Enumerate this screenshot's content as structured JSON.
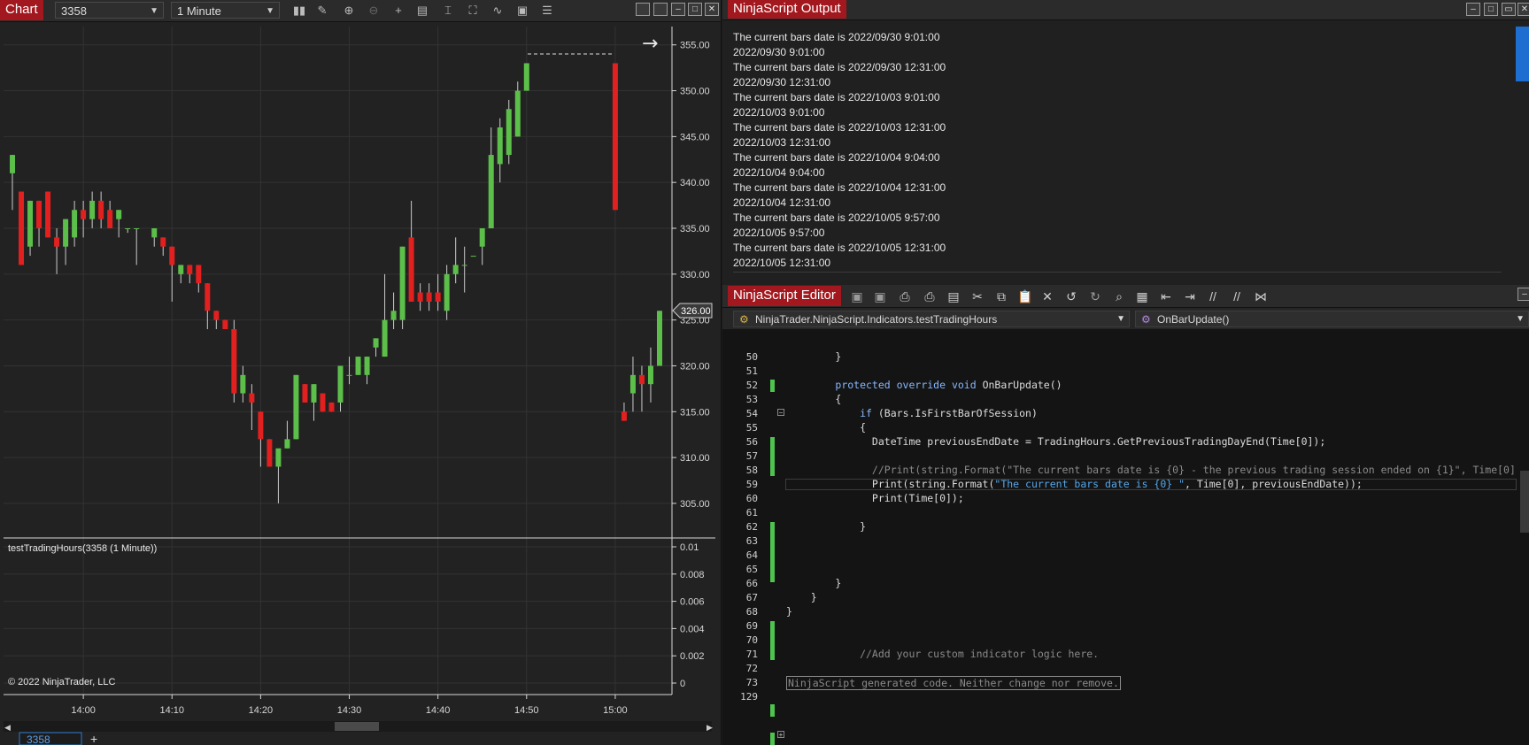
{
  "chart": {
    "tag": "Chart",
    "instrument": "3358",
    "interval": "1 Minute",
    "indicator_label": "testTradingHours(3358 (1 Minute))",
    "copyright": "© 2022 NinjaTrader, LLC",
    "current_price_label": "326.00",
    "tab_label": "3358",
    "add_tab": "+",
    "price_ticks": [
      "355.00",
      "350.00",
      "345.00",
      "340.00",
      "335.00",
      "330.00",
      "325.00",
      "320.00",
      "315.00",
      "310.00",
      "305.00"
    ],
    "indicator_ticks": [
      "0.01",
      "0.008",
      "0.006",
      "0.004",
      "0.002",
      "0"
    ],
    "time_ticks": [
      "14:00",
      "14:10",
      "14:20",
      "14:30",
      "14:40",
      "14:50",
      "15:00"
    ]
  },
  "chart_data": {
    "type": "candlestick",
    "price_range": [
      302,
      357
    ],
    "time_range_minutes": [
      "13:51",
      "15:06"
    ],
    "candles": [
      {
        "t": "13:52",
        "o": 341,
        "h": 343,
        "l": 337,
        "c": 343
      },
      {
        "t": "13:53",
        "o": 339,
        "h": 339,
        "l": 331,
        "c": 331
      },
      {
        "t": "13:54",
        "o": 333,
        "h": 338,
        "l": 332,
        "c": 338
      },
      {
        "t": "13:55",
        "o": 338,
        "h": 338,
        "l": 333,
        "c": 335
      },
      {
        "t": "13:56",
        "o": 339,
        "h": 339,
        "l": 334,
        "c": 334
      },
      {
        "t": "13:57",
        "o": 334,
        "h": 335,
        "l": 330,
        "c": 333
      },
      {
        "t": "13:58",
        "o": 333,
        "h": 336,
        "l": 331,
        "c": 336
      },
      {
        "t": "13:59",
        "o": 334,
        "h": 338,
        "l": 333,
        "c": 337
      },
      {
        "t": "14:00",
        "o": 337,
        "h": 338,
        "l": 334,
        "c": 336
      },
      {
        "t": "14:01",
        "o": 336,
        "h": 339,
        "l": 335,
        "c": 338
      },
      {
        "t": "14:02",
        "o": 338,
        "h": 339,
        "l": 335,
        "c": 336
      },
      {
        "t": "14:03",
        "o": 337,
        "h": 338,
        "l": 335,
        "c": 335
      },
      {
        "t": "14:04",
        "o": 336,
        "h": 337,
        "l": 334,
        "c": 337
      },
      {
        "t": "14:05",
        "o": 335,
        "h": 335,
        "l": 334.5,
        "c": 335
      },
      {
        "t": "14:06",
        "o": 335,
        "h": 335,
        "l": 331,
        "c": 335
      },
      {
        "t": "14:08",
        "o": 334,
        "h": 335,
        "l": 333,
        "c": 335
      },
      {
        "t": "14:09",
        "o": 334,
        "h": 334,
        "l": 332,
        "c": 333
      },
      {
        "t": "14:10",
        "o": 333,
        "h": 333,
        "l": 327,
        "c": 331
      },
      {
        "t": "14:11",
        "o": 330,
        "h": 331,
        "l": 329,
        "c": 331
      },
      {
        "t": "14:12",
        "o": 331,
        "h": 331,
        "l": 329,
        "c": 330
      },
      {
        "t": "14:13",
        "o": 331,
        "h": 331,
        "l": 328,
        "c": 329
      },
      {
        "t": "14:14",
        "o": 329,
        "h": 329,
        "l": 324,
        "c": 326
      },
      {
        "t": "14:15",
        "o": 326,
        "h": 326,
        "l": 324,
        "c": 325
      },
      {
        "t": "14:16",
        "o": 325,
        "h": 325,
        "l": 324,
        "c": 324
      },
      {
        "t": "14:17",
        "o": 324,
        "h": 325,
        "l": 316,
        "c": 317
      },
      {
        "t": "14:18",
        "o": 317,
        "h": 320,
        "l": 316,
        "c": 319
      },
      {
        "t": "14:19",
        "o": 317,
        "h": 318,
        "l": 313,
        "c": 316
      },
      {
        "t": "14:20",
        "o": 315,
        "h": 315,
        "l": 309,
        "c": 312
      },
      {
        "t": "14:21",
        "o": 312,
        "h": 312,
        "l": 309,
        "c": 309
      },
      {
        "t": "14:22",
        "o": 309,
        "h": 309,
        "l": 305,
        "c": 311
      },
      {
        "t": "14:23",
        "o": 311,
        "h": 314,
        "l": 311,
        "c": 312
      },
      {
        "t": "14:24",
        "o": 312,
        "h": 319,
        "l": 312,
        "c": 319
      },
      {
        "t": "14:25",
        "o": 318,
        "h": 318,
        "l": 316,
        "c": 316
      },
      {
        "t": "14:26",
        "o": 316,
        "h": 318,
        "l": 314,
        "c": 318
      },
      {
        "t": "14:27",
        "o": 317,
        "h": 317,
        "l": 315,
        "c": 315
      },
      {
        "t": "14:28",
        "o": 316,
        "h": 316,
        "l": 315,
        "c": 315
      },
      {
        "t": "14:29",
        "o": 316,
        "h": 320,
        "l": 315,
        "c": 320
      },
      {
        "t": "14:30",
        "o": 319,
        "h": 321,
        "l": 318,
        "c": 319
      },
      {
        "t": "14:31",
        "o": 319,
        "h": 321,
        "l": 319,
        "c": 321
      },
      {
        "t": "14:32",
        "o": 319,
        "h": 321,
        "l": 318,
        "c": 321
      },
      {
        "t": "14:33",
        "o": 322,
        "h": 323,
        "l": 321,
        "c": 323
      },
      {
        "t": "14:34",
        "o": 321,
        "h": 330,
        "l": 321,
        "c": 325
      },
      {
        "t": "14:35",
        "o": 325,
        "h": 328,
        "l": 324,
        "c": 326
      },
      {
        "t": "14:36",
        "o": 325,
        "h": 333,
        "l": 324,
        "c": 333
      },
      {
        "t": "14:37",
        "o": 334,
        "h": 338,
        "l": 327,
        "c": 327
      },
      {
        "t": "14:38",
        "o": 328,
        "h": 329,
        "l": 326,
        "c": 327
      },
      {
        "t": "14:39",
        "o": 328,
        "h": 329,
        "l": 326,
        "c": 327
      },
      {
        "t": "14:40",
        "o": 328,
        "h": 330,
        "l": 326,
        "c": 327
      },
      {
        "t": "14:41",
        "o": 326,
        "h": 331,
        "l": 325,
        "c": 330
      },
      {
        "t": "14:42",
        "o": 330,
        "h": 334,
        "l": 329,
        "c": 331
      },
      {
        "t": "14:43",
        "o": 331,
        "h": 333,
        "l": 328,
        "c": 331
      },
      {
        "t": "14:44",
        "o": 332,
        "h": 332,
        "l": 332,
        "c": 332
      },
      {
        "t": "14:45",
        "o": 333,
        "h": 334,
        "l": 331,
        "c": 335
      },
      {
        "t": "14:46",
        "o": 335,
        "h": 346,
        "l": 335,
        "c": 343
      },
      {
        "t": "14:47",
        "o": 342,
        "h": 347,
        "l": 340,
        "c": 346
      },
      {
        "t": "14:48",
        "o": 343,
        "h": 349,
        "l": 342,
        "c": 348
      },
      {
        "t": "14:49",
        "o": 345,
        "h": 351,
        "l": 345,
        "c": 350
      },
      {
        "t": "14:50",
        "o": 350,
        "h": 353,
        "l": 350,
        "c": 353
      },
      {
        "t": "15:00",
        "o": 353,
        "h": 353,
        "l": 337,
        "c": 337
      },
      {
        "t": "15:01",
        "o": 315,
        "h": 316,
        "l": 314,
        "c": 314
      },
      {
        "t": "15:02",
        "o": 317,
        "h": 321,
        "l": 315,
        "c": 319
      },
      {
        "t": "15:03",
        "o": 319,
        "h": 320,
        "l": 315,
        "c": 318
      },
      {
        "t": "15:04",
        "o": 318,
        "h": 322,
        "l": 316,
        "c": 320
      },
      {
        "t": "15:05",
        "o": 320,
        "h": 326,
        "l": 320,
        "c": 326
      }
    ],
    "colors": {
      "up": "#5cbf4a",
      "down": "#e1201f",
      "wick": "#cccccc",
      "grid": "#333333",
      "background": "#222222"
    }
  },
  "output": {
    "tag": "NinjaScript Output",
    "lines": [
      "The current bars date is 2022/09/30 9:01:00",
      "2022/09/30 9:01:00",
      "The current bars date is 2022/09/30 12:31:00",
      "2022/09/30 12:31:00",
      "The current bars date is 2022/10/03 9:01:00",
      "2022/10/03 9:01:00",
      "The current bars date is 2022/10/03 12:31:00",
      "2022/10/03 12:31:00",
      "The current bars date is 2022/10/04 9:04:00",
      "2022/10/04 9:04:00",
      "The current bars date is 2022/10/04 12:31:00",
      "2022/10/04 12:31:00",
      "The current bars date is 2022/10/05 9:57:00",
      "2022/10/05 9:57:00",
      "The current bars date is 2022/10/05 12:31:00",
      "2022/10/05 12:31:00"
    ]
  },
  "editor": {
    "tag": "NinjaScript Editor",
    "class_selector": "NinjaTrader.NinjaScript.Indicators.testTradingHours",
    "method_selector": "OnBarUpdate()",
    "line_numbers": [
      "50",
      "51",
      "52",
      "53",
      "54",
      "55",
      "56",
      "57",
      "58",
      "59",
      "60",
      "61",
      "62",
      "63",
      "64",
      "65",
      "66",
      "67",
      "68",
      "69",
      "70",
      "71",
      "72",
      "73",
      "129"
    ],
    "code": {
      "l50": "        }",
      "l52a": "        ",
      "l52kw": "protected override void",
      "l52b": " OnBarUpdate()",
      "l53": "        {",
      "l54a": "            ",
      "l54kw": "if",
      "l54b": " (Bars.IsFirstBarOfSession)",
      "l55": "            {",
      "l56": "              DateTime previousEndDate = TradingHours.GetPreviousTradingDayEnd(Time[0]);",
      "l58": "              //Print(string.Format(\"The current bars date is {0} - the previous trading session ended on {1}\", Time[0]",
      "l59a": "              Print(string.Format(",
      "l59s": "\"The current bars date is {0} \"",
      "l59b": ", Time[0], previousEndDate));",
      "l60": "              Print(Time[0]);",
      "l62": "            }",
      "l66": "        }",
      "l67": "    }",
      "l68": "}",
      "l71": "            //Add your custom indicator logic here.",
      "l73": "NinjaScript generated code. Neither change nor remove."
    }
  }
}
